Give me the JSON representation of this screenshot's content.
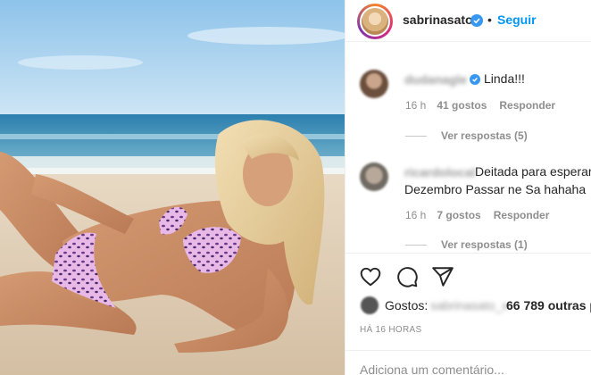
{
  "post": {
    "author": "sabrinasato",
    "follow_label": "Seguir",
    "separator": "•"
  },
  "comments": [
    {
      "username": "dudanagle",
      "verified": true,
      "text": "Linda!!!",
      "time": "16 h",
      "likes": "41 gostos",
      "reply_label": "Responder",
      "view_replies": "Ver respostas (5)"
    },
    {
      "username": "ricardolocal",
      "verified": false,
      "text_line1": "Deitada para esperar",
      "text_line2": "Dezembro Passar ne Sa hahaha",
      "time": "16 h",
      "likes": "7 gostos",
      "reply_label": "Responder",
      "view_replies": "Ver respostas (1)"
    }
  ],
  "likes_bar": {
    "label": "Gostos:",
    "liker": "sabrinasato_x",
    "others": "66 789 outras p"
  },
  "timestamp": "HÁ 16 HORAS",
  "add_comment": {
    "placeholder": "Adiciona um comentário..."
  },
  "icons": {
    "verified": "verified-badge-icon",
    "like": "heart-icon",
    "comment": "comment-bubble-icon",
    "share": "paper-plane-icon"
  },
  "colors": {
    "link_blue": "#0095f6",
    "verified_blue": "#3897f0",
    "secondary_text": "#8e8e8e"
  }
}
